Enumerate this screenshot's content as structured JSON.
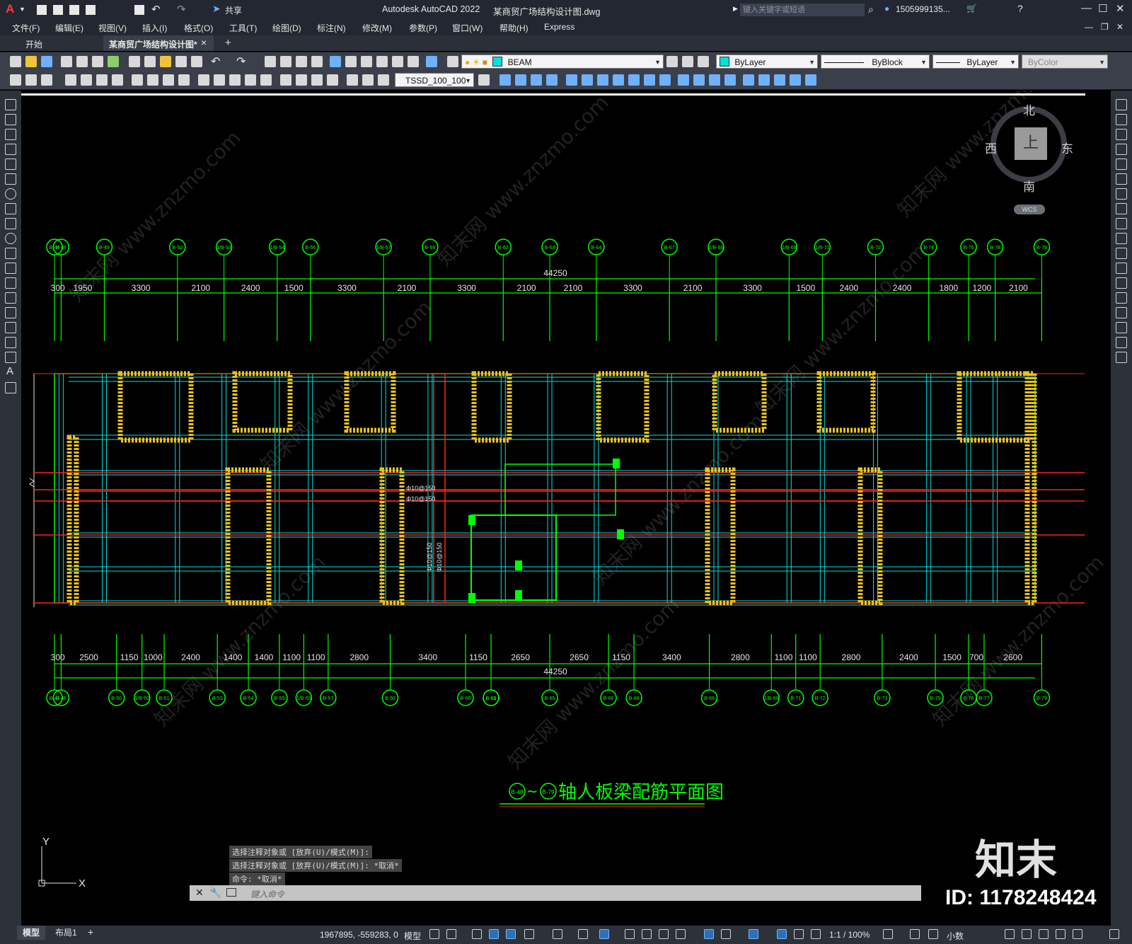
{
  "titlebar": {
    "app_title": "Autodesk AutoCAD 2022",
    "doc_title": "某商贸广场结构设计图.dwg",
    "share": "共享",
    "search_placeholder": "键入关键字或短语",
    "user": "1505999135...",
    "app_letter": "A"
  },
  "menubar": {
    "items": [
      "文件(F)",
      "编辑(E)",
      "视图(V)",
      "插入(I)",
      "格式(O)",
      "工具(T)",
      "绘图(D)",
      "标注(N)",
      "修改(M)",
      "参数(P)",
      "窗口(W)",
      "帮助(H)",
      "Express"
    ]
  },
  "tabs": {
    "start": "开始",
    "doc": "某商贸广场结构设计图*",
    "close": "×",
    "new": "+"
  },
  "toolbar": {
    "layer": "BEAM",
    "color": "ByLayer",
    "linetype": "ByBlock",
    "lineweight": "ByLayer",
    "plotstyle": "ByColor",
    "dimstyle": "TSSD_100_100"
  },
  "viewcube": {
    "north": "北",
    "south": "南",
    "east": "东",
    "west": "西",
    "top": "上",
    "wcs": "WCS"
  },
  "drawing": {
    "top_total": "44250",
    "top_dims": [
      "300",
      "1950",
      "3300",
      "2100",
      "2400",
      "1500",
      "3300",
      "2100",
      "3300",
      "2100",
      "2100",
      "3300",
      "2100",
      "3300",
      "1500",
      "2400",
      "2400",
      "1800",
      "1200",
      "2100"
    ],
    "top_axes": [
      "B-47",
      "B-48",
      "B-49",
      "B-52",
      "1/B-53",
      "1/B-54",
      "B-56",
      "1/B-57",
      "B-59",
      "B-62",
      "B-63",
      "B-64",
      "B-67",
      "1/B-68",
      "1/B-69",
      "1/B-71",
      "B-72",
      "B-74",
      "B-76",
      "B-78",
      "B-79"
    ],
    "bottom_total": "44250",
    "bottom_dims": [
      "300",
      "2500",
      "1150",
      "1000",
      "2400",
      "1400",
      "1400",
      "1100",
      "1100",
      "2800",
      "3400",
      "1150",
      "2650",
      "2650",
      "1150",
      "3400",
      "2800",
      "1100",
      "1100",
      "2800",
      "2400",
      "1500",
      "700",
      "2600"
    ],
    "bottom_axes": [
      "B-47",
      "B-48",
      "B-50",
      "1/B-50",
      "B-51",
      "B-53",
      "B-54",
      "B-55",
      "1/B-55",
      "B-57",
      "B-58",
      "B-60",
      "B-61",
      "B-63",
      "B-65",
      "B-66",
      "B-68",
      "B-69",
      "1/B-69",
      "B-71",
      "B-72",
      "B-73",
      "B-75",
      "B-76",
      "B-77",
      "B-79"
    ],
    "rebar_labels": [
      "Φ10@150",
      "Φ10@150",
      "Φ10@150",
      "Φ10@150"
    ],
    "plan_title": "轴人板梁配筋平面图",
    "title_axis_from": "B-48",
    "title_axis_to": "B-79",
    "title_tilde": "~",
    "ucs_x": "X",
    "ucs_y": "Y"
  },
  "command": {
    "history": [
      "选择注释对象或 [放弃(U)/模式(M)]:",
      "选择注释对象或 [放弃(U)/模式(M)]: *取消*",
      "命令: *取消*"
    ],
    "placeholder": "键入命令"
  },
  "statusbar": {
    "tab_model": "模型",
    "tab_layout": "布局1",
    "coords": "1967895, -559283, 0",
    "model": "模型",
    "scale": "1:1 / 100%",
    "units": "小数"
  },
  "watermark": {
    "brand": "知末",
    "id": "ID: 1178248424",
    "site": "www.znzmo.com",
    "site_cn": "知末网"
  },
  "colors": {
    "grid_green": "#00ff00",
    "beam_cyan": "#00e0e0",
    "wall_red": "#ff2020",
    "column_yellow": "#e8c020",
    "title_green": "#00ff00"
  }
}
